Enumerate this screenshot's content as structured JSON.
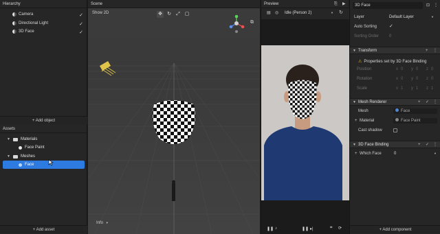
{
  "hierarchy": {
    "title": "Hierarchy",
    "items": [
      {
        "label": "Camera",
        "checked": "✓"
      },
      {
        "label": "Directional Light",
        "checked": "✓"
      },
      {
        "label": "3D Face",
        "checked": "✓"
      }
    ],
    "add_button": "+ Add object"
  },
  "assets": {
    "title": "Assets",
    "items": [
      {
        "label": "Materials"
      },
      {
        "label": "Face Paint"
      },
      {
        "label": "Meshes"
      },
      {
        "label": "Face"
      }
    ],
    "add_button": "+ Add asset"
  },
  "scene": {
    "title": "Scene",
    "view_mode": "Show 2D",
    "info_label": "Info"
  },
  "preview": {
    "title": "Preview",
    "video_label": "Idle (Person 2)"
  },
  "inspector": {
    "object_name": "3D Face",
    "layer_label": "Layer",
    "layer_value": "Default Layer",
    "auto_sorting_label": "Auto Sorting",
    "auto_sorting_check": "✓",
    "sorting_order_label": "Sorting Order",
    "sorting_order_value": "0",
    "transform": {
      "title": "Transform",
      "notice": "Properties set by 3D Face Binding",
      "position_label": "Position",
      "rotation_label": "Rotation",
      "scale_label": "Scale",
      "position": [
        "0",
        "0",
        "0"
      ],
      "rotation": [
        "0",
        "0",
        "0"
      ],
      "scale": [
        "1",
        "1",
        "1"
      ]
    },
    "mesh_renderer": {
      "title": "Mesh Renderer",
      "mesh_label": "Mesh",
      "mesh_value": "Face",
      "material_label": "Material",
      "material_value": "Face Paint",
      "cast_shadow_label": "Cast shadow"
    },
    "face_binding": {
      "title": "3D Face Binding",
      "which_face_label": "Which Face",
      "which_face_value": "0"
    },
    "add_button": "+ Add component"
  },
  "colors": {
    "accent": "#2d7be0",
    "warning": "#f0b400"
  }
}
